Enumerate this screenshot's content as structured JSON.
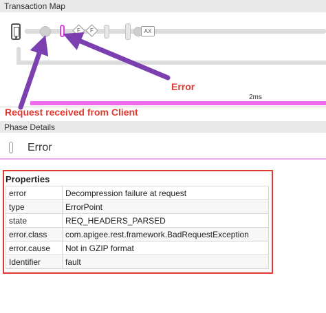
{
  "transaction_map": {
    "title": "Transaction Map",
    "device_icon": "mobile-phone-icon",
    "flow_labels": [
      "F",
      "F"
    ],
    "ax_label": "AX",
    "duration": "2ms",
    "error_color": "#e040e0",
    "bar_color": "#f06af0"
  },
  "annotations": {
    "error": "Error",
    "request": "Request received from Client",
    "arrow_color": "#7b3fb0",
    "text_color": "#e03a30"
  },
  "phase_details": {
    "title": "Phase Details",
    "status": "Error"
  },
  "properties": {
    "title": "Properties",
    "rows": [
      {
        "key": "error",
        "value": "Decompression failure at request"
      },
      {
        "key": "type",
        "value": "ErrorPoint"
      },
      {
        "key": "state",
        "value": "REQ_HEADERS_PARSED"
      },
      {
        "key": "error.class",
        "value": "com.apigee.rest.framework.BadRequestException"
      },
      {
        "key": "error.cause",
        "value": "Not in GZIP format"
      },
      {
        "key": "Identifier",
        "value": "fault"
      }
    ]
  }
}
